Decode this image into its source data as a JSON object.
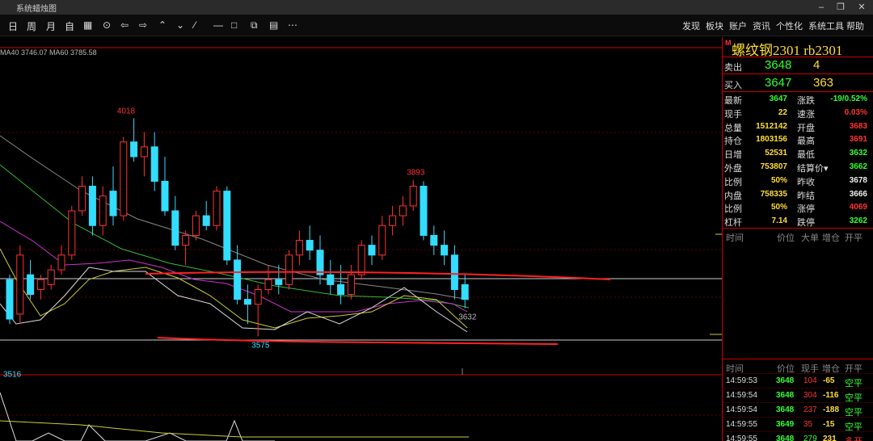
{
  "window": {
    "title": "系统蜡烛图"
  },
  "toolbar": {
    "tools": [
      {
        "label": "日",
        "name": "period-day-button"
      },
      {
        "label": "周",
        "name": "period-week-button"
      },
      {
        "label": "月",
        "name": "period-month-button"
      },
      {
        "label": "自",
        "name": "period-custom-button"
      },
      {
        "label": "▦",
        "name": "grid-icon"
      },
      {
        "label": "⊙",
        "name": "crosshair-icon"
      },
      {
        "label": "⇦",
        "name": "arrow-left-icon"
      },
      {
        "label": "⇨",
        "name": "arrow-right-icon"
      },
      {
        "label": "⌃",
        "name": "zoom-in-icon"
      },
      {
        "label": "⌄",
        "name": "zoom-out-icon"
      },
      {
        "label": "⁄",
        "name": "draw-line-icon"
      },
      {
        "label": "—",
        "name": "hline-icon"
      },
      {
        "label": "□",
        "name": "rect-icon"
      },
      {
        "label": "⧉",
        "name": "template-icon"
      },
      {
        "label": "▤",
        "name": "indicator-icon"
      },
      {
        "label": "⋯",
        "name": "more-icon"
      }
    ],
    "menus": [
      "发现",
      "板块",
      "账户",
      "资讯",
      "个性化",
      "系统工具",
      "帮助"
    ]
  },
  "ma_legend": "MA40 3746.07  MA60 3785.58",
  "instrument": {
    "mark": "M",
    "name": "螺纹钢2301  rb2301"
  },
  "quotes": {
    "ask": {
      "label": "卖出",
      "price": "3648",
      "vol": "4"
    },
    "bid": {
      "label": "买入",
      "price": "3647",
      "vol": "363"
    }
  },
  "stats": [
    {
      "l1": "最新",
      "v1": "3647",
      "c1": "#3f3",
      "l2": "涨跌",
      "v2": "-19/0.52%",
      "c2": "#3f3"
    },
    {
      "l1": "现手",
      "v1": "22",
      "c1": "#ffde33",
      "l2": "速涨",
      "v2": "0.03%",
      "c2": "#f33"
    },
    {
      "l1": "总量",
      "v1": "1512142",
      "c1": "#ffde33",
      "l2": "开盘",
      "v2": "3683",
      "c2": "#f33"
    },
    {
      "l1": "持仓",
      "v1": "1803156",
      "c1": "#ffde33",
      "l2": "最高",
      "v2": "3691",
      "c2": "#f33"
    },
    {
      "l1": "日增",
      "v1": "52531",
      "c1": "#ffde33",
      "l2": "最低",
      "v2": "3632",
      "c2": "#3f3"
    },
    {
      "l1": "外盘",
      "v1": "753807",
      "c1": "#ffde33",
      "l2": "结算价▾",
      "v2": "3662",
      "c2": "#3f3"
    },
    {
      "l1": "比例",
      "v1": "50%",
      "c1": "#ffde33",
      "l2": "昨收",
      "v2": "3678",
      "c2": "#eee"
    },
    {
      "l1": "内盘",
      "v1": "758335",
      "c1": "#ffde33",
      "l2": "昨结",
      "v2": "3666",
      "c2": "#eee"
    },
    {
      "l1": "比例",
      "v1": "50%",
      "c1": "#ffde33",
      "l2": "涨停",
      "v2": "4069",
      "c2": "#f33"
    },
    {
      "l1": "杠杆",
      "v1": "7.14",
      "c1": "#ffde33",
      "l2": "跌停",
      "v2": "3262",
      "c2": "#3f3"
    }
  ],
  "block_header": [
    "时间",
    "价位",
    "大单",
    "增仓",
    "开平"
  ],
  "tick_header": [
    "时间",
    "价位",
    "现手",
    "增仓",
    "开平"
  ],
  "ticks": [
    {
      "time": "14:59:53",
      "price": "3648",
      "vol": "104",
      "oi": "-65",
      "type": "空平",
      "vc": "#f33",
      "oc": "#3f3"
    },
    {
      "time": "14:59:54",
      "price": "3648",
      "vol": "304",
      "oi": "-116",
      "type": "空平",
      "vc": "#f33",
      "oc": "#3f3"
    },
    {
      "time": "14:59:54",
      "price": "3648",
      "vol": "237",
      "oi": "-188",
      "type": "空平",
      "vc": "#f33",
      "oc": "#3f3"
    },
    {
      "time": "14:59:55",
      "price": "3649",
      "vol": "35",
      "oi": "-15",
      "type": "空平",
      "vc": "#f33",
      "oc": "#3f3"
    },
    {
      "time": "14:59:55",
      "price": "3648",
      "vol": "279",
      "oi": "231",
      "type": "多开",
      "vc": "#3f3",
      "oc": "#f33"
    }
  ],
  "chart_data": {
    "type": "candlestick",
    "ylim": [
      3500,
      4160
    ],
    "annotations": [
      {
        "text": "4018",
        "x": 11,
        "y": 4018,
        "color": "#f33"
      },
      {
        "text": "3893",
        "x": 39,
        "y": 3893,
        "color": "#f33"
      },
      {
        "text": "3575",
        "x": 24,
        "y": 3575,
        "color": "#3df"
      },
      {
        "text": "3632",
        "x": 44,
        "y": 3632,
        "color": "#bbb"
      },
      {
        "text": "3516",
        "x": 0,
        "y": 3516,
        "color": "#3df"
      }
    ],
    "candles": [
      {
        "o": 3690,
        "h": 3700,
        "l": 3600,
        "c": 3610
      },
      {
        "o": 3620,
        "h": 3760,
        "l": 3600,
        "c": 3740
      },
      {
        "o": 3700,
        "h": 3730,
        "l": 3650,
        "c": 3660
      },
      {
        "o": 3670,
        "h": 3700,
        "l": 3650,
        "c": 3690
      },
      {
        "o": 3680,
        "h": 3720,
        "l": 3670,
        "c": 3710
      },
      {
        "o": 3710,
        "h": 3760,
        "l": 3700,
        "c": 3740
      },
      {
        "o": 3740,
        "h": 3840,
        "l": 3730,
        "c": 3830
      },
      {
        "o": 3830,
        "h": 3900,
        "l": 3820,
        "c": 3880
      },
      {
        "o": 3880,
        "h": 3900,
        "l": 3780,
        "c": 3800
      },
      {
        "o": 3800,
        "h": 3880,
        "l": 3780,
        "c": 3860
      },
      {
        "o": 3870,
        "h": 3920,
        "l": 3800,
        "c": 3820
      },
      {
        "o": 3820,
        "h": 3980,
        "l": 3810,
        "c": 3970
      },
      {
        "o": 3970,
        "h": 4018,
        "l": 3930,
        "c": 3940
      },
      {
        "o": 3940,
        "h": 3990,
        "l": 3900,
        "c": 3960
      },
      {
        "o": 3960,
        "h": 3990,
        "l": 3870,
        "c": 3890
      },
      {
        "o": 3890,
        "h": 3940,
        "l": 3820,
        "c": 3830
      },
      {
        "o": 3830,
        "h": 3860,
        "l": 3750,
        "c": 3760
      },
      {
        "o": 3760,
        "h": 3790,
        "l": 3720,
        "c": 3780
      },
      {
        "o": 3780,
        "h": 3830,
        "l": 3770,
        "c": 3820
      },
      {
        "o": 3820,
        "h": 3850,
        "l": 3790,
        "c": 3800
      },
      {
        "o": 3800,
        "h": 3880,
        "l": 3790,
        "c": 3870
      },
      {
        "o": 3870,
        "h": 3880,
        "l": 3720,
        "c": 3730
      },
      {
        "o": 3730,
        "h": 3760,
        "l": 3640,
        "c": 3650
      },
      {
        "o": 3650,
        "h": 3680,
        "l": 3600,
        "c": 3640
      },
      {
        "o": 3640,
        "h": 3680,
        "l": 3575,
        "c": 3670
      },
      {
        "o": 3670,
        "h": 3720,
        "l": 3660,
        "c": 3690
      },
      {
        "o": 3690,
        "h": 3720,
        "l": 3660,
        "c": 3680
      },
      {
        "o": 3680,
        "h": 3750,
        "l": 3670,
        "c": 3740
      },
      {
        "o": 3740,
        "h": 3790,
        "l": 3720,
        "c": 3770
      },
      {
        "o": 3770,
        "h": 3800,
        "l": 3730,
        "c": 3750
      },
      {
        "o": 3750,
        "h": 3780,
        "l": 3680,
        "c": 3700
      },
      {
        "o": 3700,
        "h": 3730,
        "l": 3660,
        "c": 3680
      },
      {
        "o": 3680,
        "h": 3720,
        "l": 3640,
        "c": 3660
      },
      {
        "o": 3660,
        "h": 3720,
        "l": 3650,
        "c": 3700
      },
      {
        "o": 3700,
        "h": 3770,
        "l": 3690,
        "c": 3760
      },
      {
        "o": 3760,
        "h": 3780,
        "l": 3720,
        "c": 3740
      },
      {
        "o": 3740,
        "h": 3820,
        "l": 3730,
        "c": 3800
      },
      {
        "o": 3800,
        "h": 3840,
        "l": 3780,
        "c": 3820
      },
      {
        "o": 3820,
        "h": 3860,
        "l": 3800,
        "c": 3840
      },
      {
        "o": 3840,
        "h": 3893,
        "l": 3830,
        "c": 3880
      },
      {
        "o": 3880,
        "h": 3890,
        "l": 3770,
        "c": 3780
      },
      {
        "o": 3780,
        "h": 3800,
        "l": 3740,
        "c": 3760
      },
      {
        "o": 3760,
        "h": 3790,
        "l": 3720,
        "c": 3740
      },
      {
        "o": 3740,
        "h": 3760,
        "l": 3650,
        "c": 3670
      },
      {
        "o": 3680,
        "h": 3700,
        "l": 3632,
        "c": 3650
      }
    ]
  }
}
